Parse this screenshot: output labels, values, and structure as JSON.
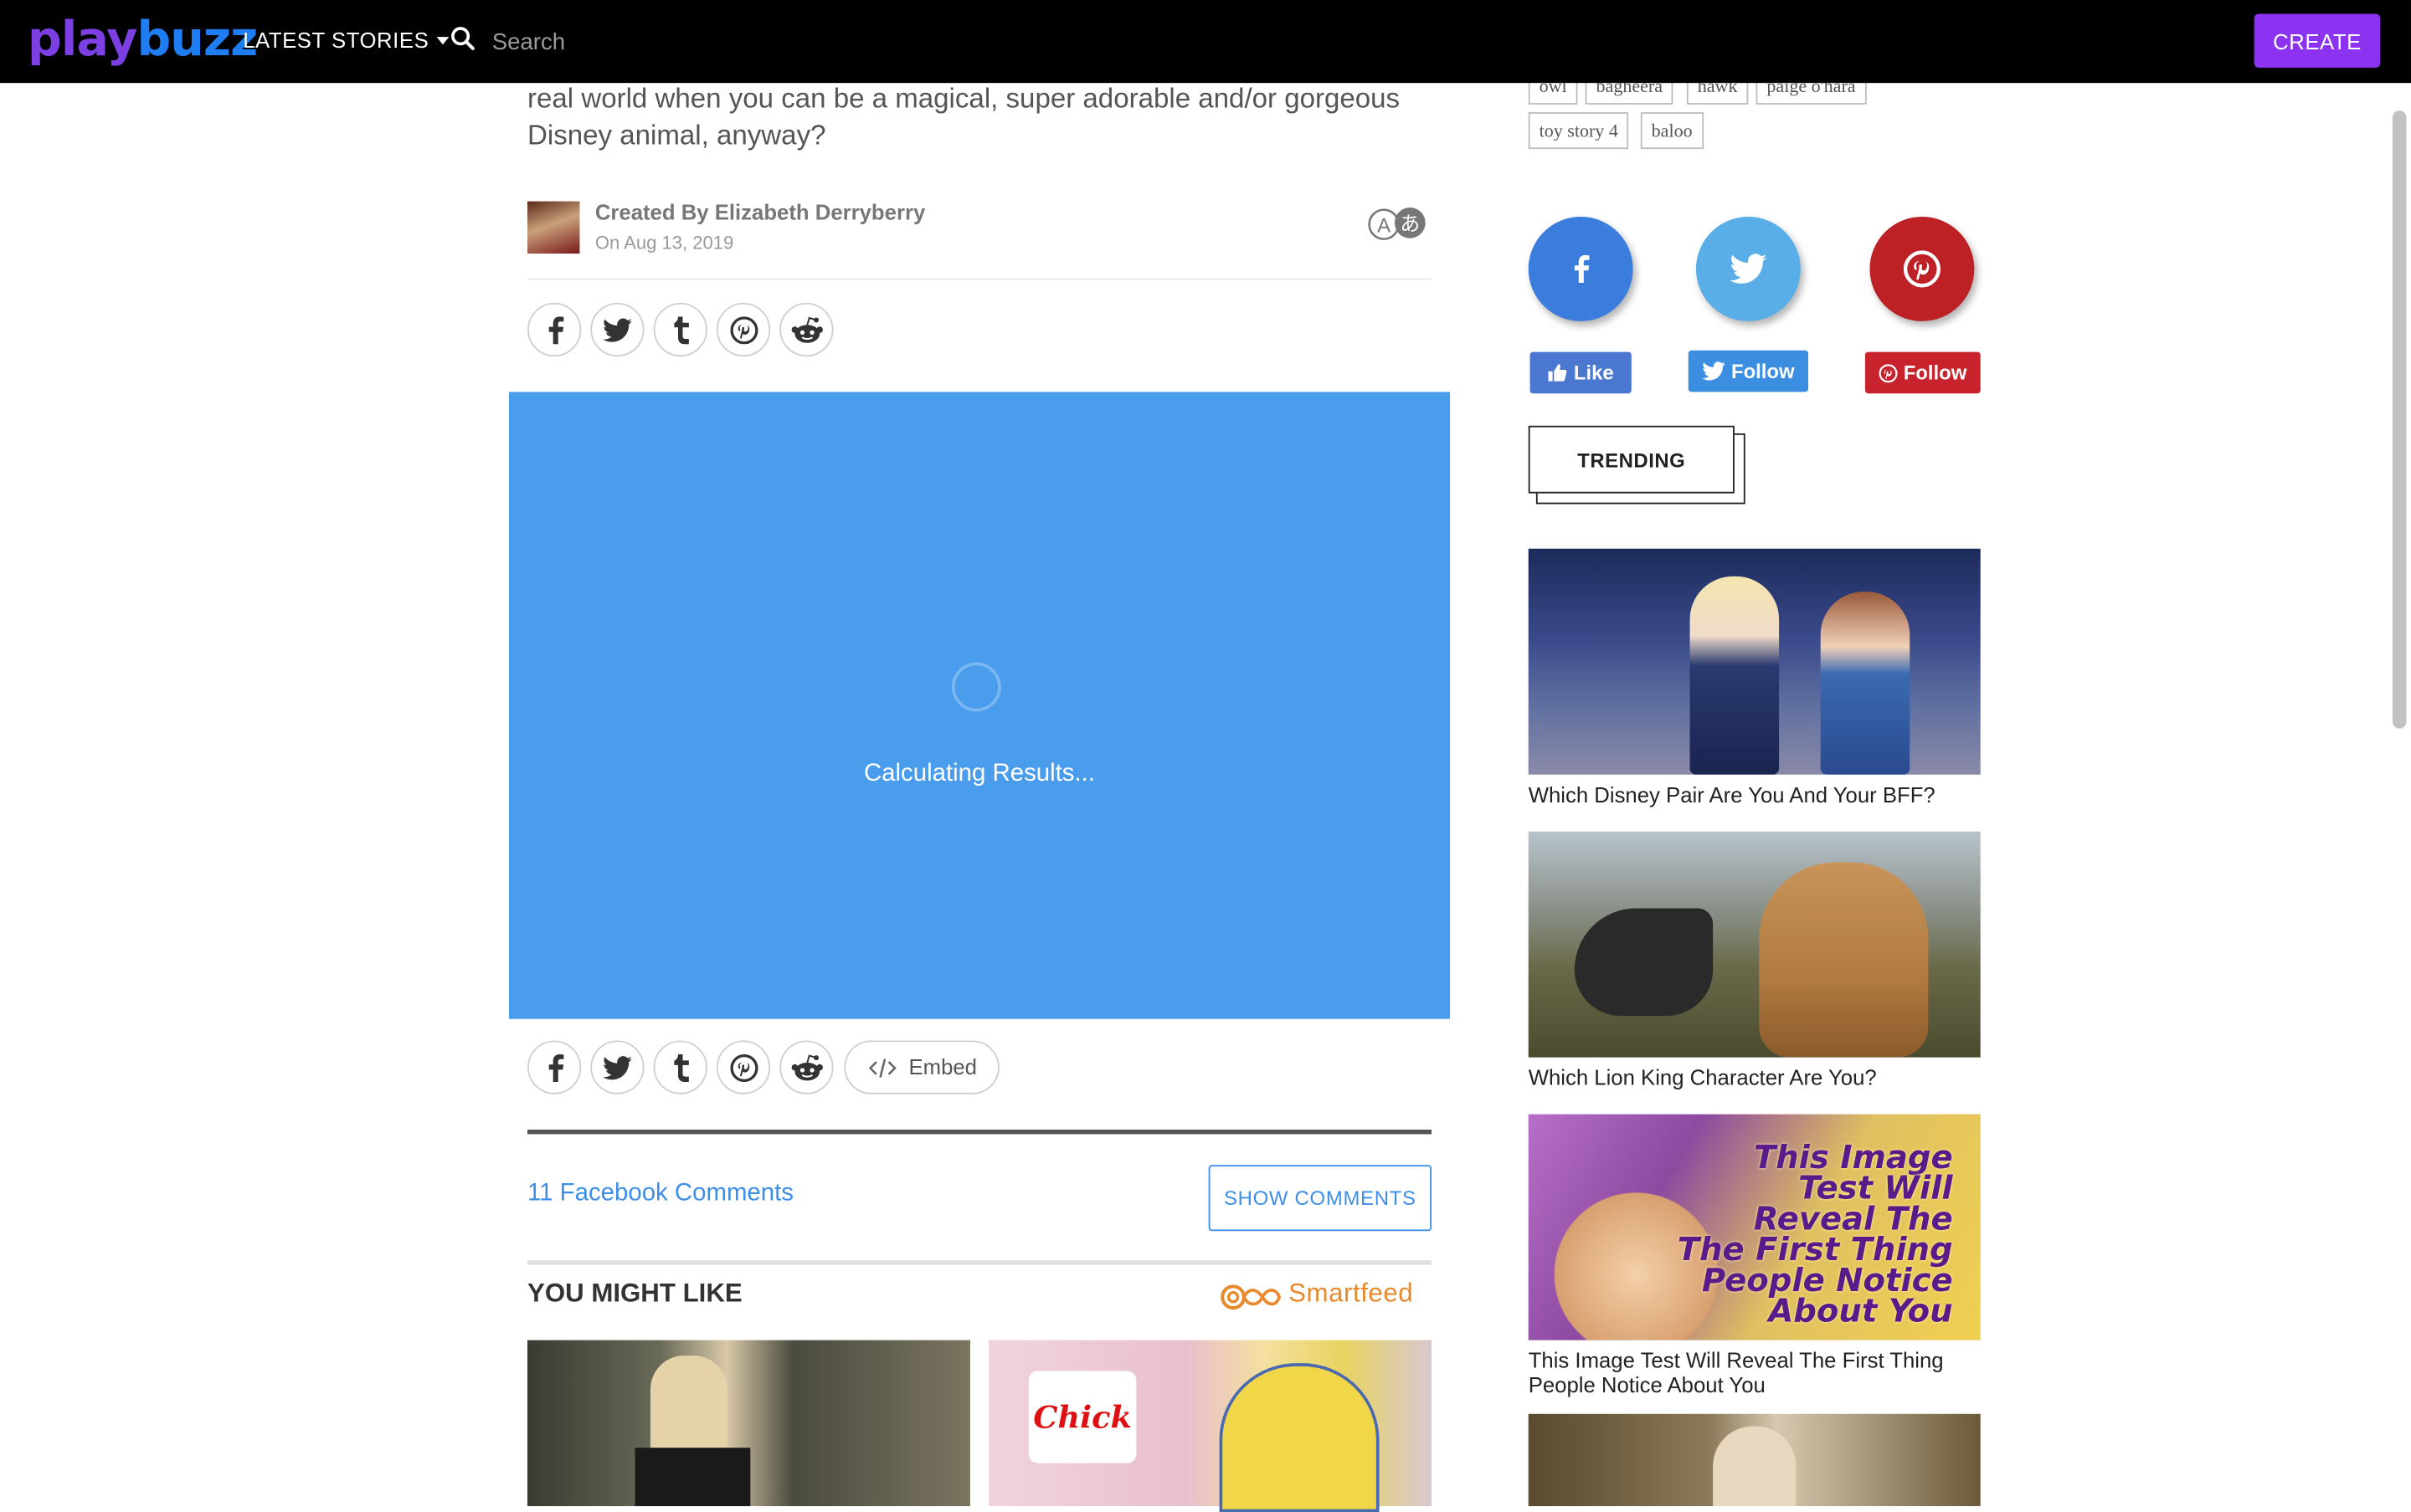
{
  "header": {
    "logo_play": "play",
    "logo_buzz": "buzz",
    "latest_stories": "LATEST STORIES",
    "search_placeholder": "Search",
    "create_label": "CREATE"
  },
  "tags": {
    "row1": [
      "owl",
      "bagheera",
      "hawk",
      "paige o'hara"
    ],
    "row2": [
      "toy story 4",
      "baloo"
    ]
  },
  "article": {
    "intro": "real world when you can be a magical, super adorable and/or gorgeous Disney animal, anyway?",
    "created_by": "Created By Elizabeth Derryberry",
    "date": "On Aug 13, 2019",
    "translate_icon": "translate-icon"
  },
  "quiz": {
    "status": "Calculating Results..."
  },
  "share": {
    "embed_label": "Embed",
    "icons": [
      "facebook-icon",
      "twitter-icon",
      "tumblr-icon",
      "pinterest-icon",
      "reddit-icon"
    ]
  },
  "comments": {
    "count_label": "11 Facebook Comments",
    "show_label": "SHOW COMMENTS"
  },
  "you_might_like": {
    "heading": "YOU MIGHT LIKE",
    "smartfeed": "Smartfeed",
    "thumb2_logo": "Chick"
  },
  "social": {
    "like_label": "Like",
    "follow_twitter_label": "Follow",
    "follow_pinterest_label": "Follow",
    "colors": {
      "facebook": "#3b7ddd",
      "twitter": "#5aaee8",
      "pinterest": "#bd2126"
    }
  },
  "trending": {
    "heading": "TRENDING",
    "items": [
      {
        "title": "Which Disney Pair Are You And Your BFF?"
      },
      {
        "title": "Which Lion King Character Are You?"
      },
      {
        "title": "This Image Test Will Reveal The First Thing People Notice About You",
        "image_text": "This Image Test Will Reveal The The First Thing People Notice About You"
      },
      {
        "title": ""
      }
    ]
  }
}
